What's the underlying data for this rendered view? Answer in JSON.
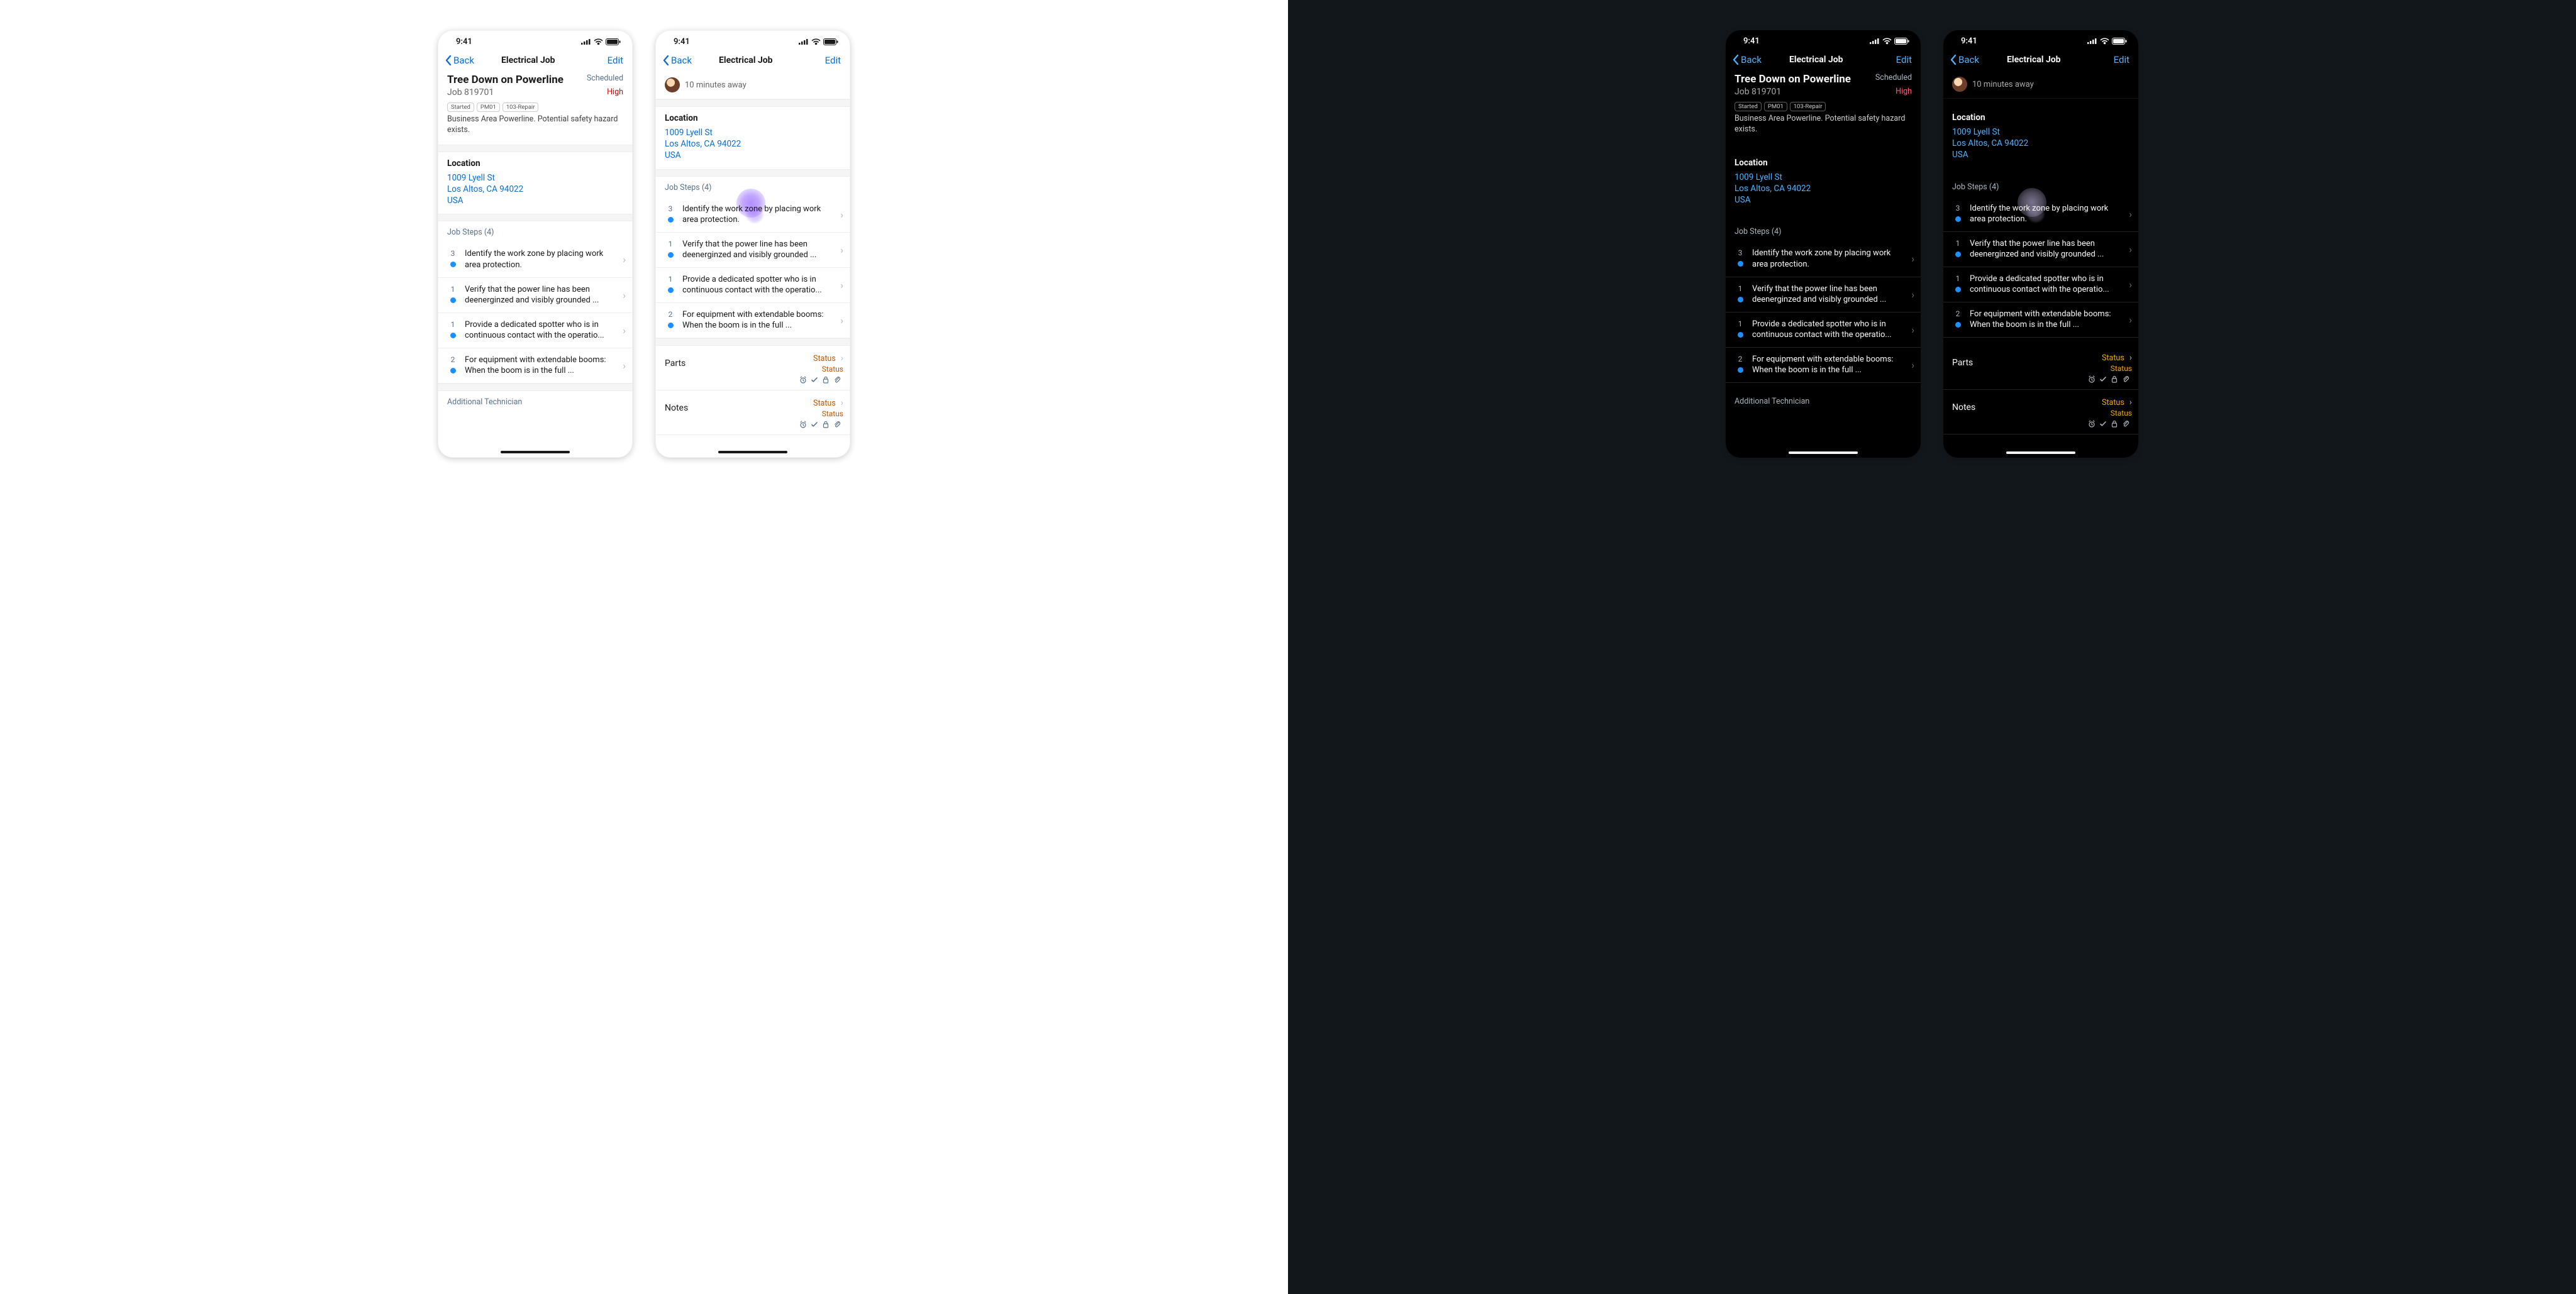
{
  "status_bar": {
    "time": "9:41"
  },
  "nav": {
    "back": "Back",
    "title": "Electrical Job",
    "edit": "Edit"
  },
  "job": {
    "title": "Tree Down on Powerline",
    "status": "Scheduled",
    "code": "Job 819701",
    "priority": "High",
    "tags": [
      "Started",
      "PM01",
      "103-Repair"
    ],
    "desc": "Business Area Powerline. Potential safety hazard exists."
  },
  "location": {
    "title": "Location",
    "line1": "1009 Lyell St",
    "line2": "Los Altos, CA 94022",
    "line3": "USA"
  },
  "steps_header": "Job Steps (4)",
  "steps": [
    {
      "n": "3",
      "text": "Identify the work zone by placing work area protection."
    },
    {
      "n": "1",
      "text": "Verify that the power line has been deenerginzed and visibly grounded ..."
    },
    {
      "n": "1",
      "text": "Provide a dedicated spotter who is in continuous contact with the operatio..."
    },
    {
      "n": "2",
      "text": "For equipment with extendable booms: When the boom is in the full ..."
    }
  ],
  "additional_tech_header": "Additional Technician",
  "infobar": {
    "text": "10 minutes away"
  },
  "rows": {
    "parts": {
      "label": "Parts",
      "status": "Status",
      "sub": "Status"
    },
    "notes": {
      "label": "Notes",
      "status": "Status",
      "sub": "Status"
    }
  }
}
